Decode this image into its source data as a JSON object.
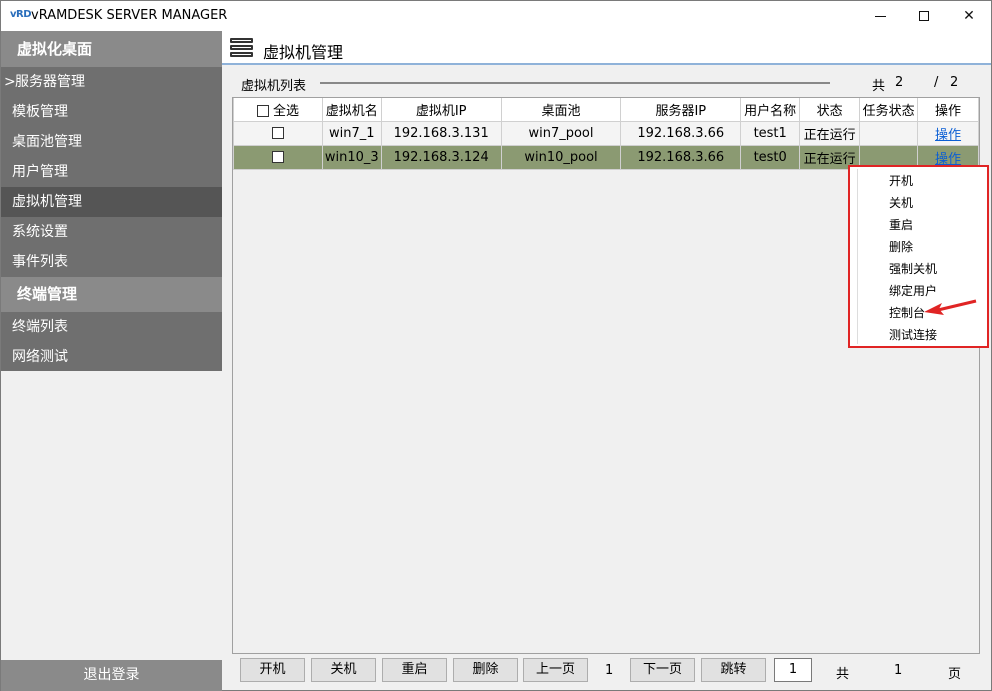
{
  "window": {
    "logo": "vRD",
    "title": "vRAMDESK SERVER MANAGER"
  },
  "sidebar": {
    "section1": "虚拟化桌面",
    "items1": [
      {
        "label": "服务器管理"
      },
      {
        "label": "模板管理"
      },
      {
        "label": "桌面池管理"
      },
      {
        "label": "用户管理"
      },
      {
        "label": "虚拟机管理"
      },
      {
        "label": "系统设置"
      },
      {
        "label": "事件列表"
      }
    ],
    "section2": "终端管理",
    "items2": [
      {
        "label": "终端列表"
      },
      {
        "label": "网络测试"
      }
    ],
    "chevron": ">",
    "logout": "退出登录"
  },
  "main": {
    "title": "虚拟机管理",
    "list_label": "虚拟机列表",
    "total_label": "共",
    "total_count": "2",
    "page_slash": "/",
    "page_count": "2"
  },
  "table": {
    "headers": [
      "全选",
      "虚拟机名",
      "虚拟机IP",
      "桌面池",
      "服务器IP",
      "用户名称",
      "状态",
      "任务状态",
      "操作"
    ],
    "rows": [
      {
        "name": "win7_1",
        "ip": "192.168.3.131",
        "pool": "win7_pool",
        "server_ip": "192.168.3.66",
        "user": "test1",
        "status": "正在运行",
        "task": "",
        "op": "操作"
      },
      {
        "name": "win10_3",
        "ip": "192.168.3.124",
        "pool": "win10_pool",
        "server_ip": "192.168.3.66",
        "user": "test0",
        "status": "正在运行",
        "task": "",
        "op": "操作"
      }
    ]
  },
  "context_menu": {
    "items": [
      "开机",
      "关机",
      "重启",
      "删除",
      "强制关机",
      "绑定用户",
      "控制台",
      "测试连接"
    ]
  },
  "toolbar": {
    "power_on": "开机",
    "power_off": "关机",
    "restart": "重启",
    "delete": "删除",
    "prev": "上一页",
    "current_page": "1",
    "next": "下一页",
    "jump": "跳转",
    "jump_value": "1",
    "total_label": "共",
    "total_pages": "1",
    "page_unit": "页"
  },
  "colors": {
    "sidebar": "#6f6f6f",
    "sidebar_active": "#555555",
    "selected_row": "#8b9a72",
    "highlight_box": "#e02424",
    "link": "#0b5fd4"
  }
}
